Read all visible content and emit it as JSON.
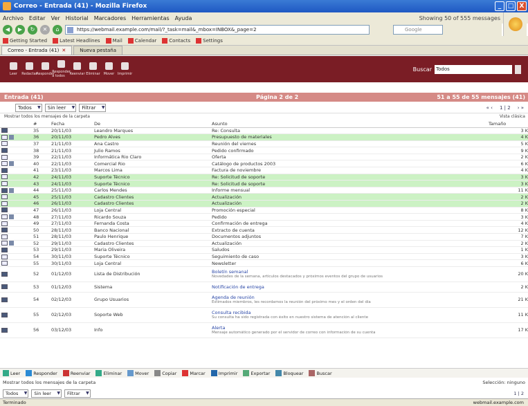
{
  "window": {
    "title": "Correo - Entrada (41) - Mozilla Firefox",
    "min": "_",
    "max": "□",
    "close": "X"
  },
  "menu": [
    "Archivo",
    "Editar",
    "Ver",
    "Historial",
    "Marcadores",
    "Herramientas",
    "Ayuda"
  ],
  "menu_status": "Showing 50 of 555 messages",
  "nav": {
    "url": "https://webmail.example.com/mail/?_task=mail&_mbox=INBOX&_page=2",
    "search_placeholder": "Google"
  },
  "bookmarks": [
    "Getting Started",
    "Latest Headlines",
    "Mail",
    "Calendar",
    "Contacts",
    "Settings"
  ],
  "tabs": [
    {
      "label": "Correo - Entrada (41)"
    },
    {
      "label": "Nueva pestaña"
    }
  ],
  "toolbar": {
    "items": [
      "Leer",
      "Redactar",
      "Responder",
      "Responder a todos",
      "Reenviar",
      "Eliminar",
      "Mover",
      "Imprimir"
    ],
    "search_label": "Buscar",
    "search_value": "Todos"
  },
  "inbox": {
    "folder": "Entrada (41)",
    "page": "Página 2 de 2",
    "count": "51 a 55 de 55 mensajes (41)"
  },
  "filters": {
    "sel1": "Todos",
    "sel2": "Sin leer",
    "sel3": "Filtrar",
    "pager": [
      "« ‹",
      "1 | 2",
      "› »"
    ]
  },
  "subfilter": {
    "left": "Mostrar todos los mensajes de la carpeta",
    "right": "Vista clásica"
  },
  "columns": [
    "",
    "#",
    "Fecha",
    "De",
    "Asunto",
    "Tamaño"
  ],
  "rows": [
    {
      "n": "35",
      "date": "20/11/03",
      "from": "Leandro Marques",
      "subject": "Re: Consulta",
      "size": "3 K",
      "green": false
    },
    {
      "n": "36",
      "date": "20/11/03",
      "from": "Pedro Alves",
      "subject": "Presupuesto de materiales",
      "size": "4 K",
      "green": true
    },
    {
      "n": "37",
      "date": "21/11/03",
      "from": "Ana Castro",
      "subject": "Reunión del viernes",
      "size": "5 K",
      "green": false
    },
    {
      "n": "38",
      "date": "21/11/03",
      "from": "Julio Ramos",
      "subject": "Pedido confirmado",
      "size": "9 K",
      "green": false
    },
    {
      "n": "39",
      "date": "22/11/03",
      "from": "Informática Rio Claro",
      "subject": "Oferta",
      "size": "2 K",
      "green": false
    },
    {
      "n": "40",
      "date": "22/11/03",
      "from": "Comercial Rio",
      "subject": "Catálogo de productos 2003",
      "size": "6 K",
      "green": false
    },
    {
      "n": "41",
      "date": "23/11/03",
      "from": "Marcos Lima",
      "subject": "Factura de noviembre",
      "size": "4 K",
      "green": false
    },
    {
      "n": "42",
      "date": "24/11/03",
      "from": "Suporte Técnico",
      "subject": "Re: Solicitud de soporte",
      "size": "3 K",
      "green": true
    },
    {
      "n": "43",
      "date": "24/11/03",
      "from": "Suporte Técnico",
      "subject": "Re: Solicitud de soporte",
      "size": "3 K",
      "green": true
    },
    {
      "n": "44",
      "date": "25/11/03",
      "from": "Carlos Mendes",
      "subject": "Informe mensual",
      "size": "11 K",
      "green": false
    },
    {
      "n": "45",
      "date": "25/11/03",
      "from": "Cadastro Clientes",
      "subject": "Actualización",
      "size": "2 K",
      "green": true
    },
    {
      "n": "46",
      "date": "26/11/03",
      "from": "Cadastro Clientes",
      "subject": "Actualización",
      "size": "2 K",
      "green": true
    },
    {
      "n": "47",
      "date": "26/11/03",
      "from": "Loja Central",
      "subject": "Promoción especial",
      "size": "8 K",
      "green": false
    },
    {
      "n": "48",
      "date": "27/11/03",
      "from": "Ricardo Souza",
      "subject": "Pedido",
      "size": "3 K",
      "green": false
    },
    {
      "n": "49",
      "date": "27/11/03",
      "from": "Fernanda Costa",
      "subject": "Confirmación de entrega",
      "size": "4 K",
      "green": false
    },
    {
      "n": "50",
      "date": "28/11/03",
      "from": "Banco Nacional",
      "subject": "Extracto de cuenta",
      "size": "12 K",
      "green": false
    },
    {
      "n": "51",
      "date": "28/11/03",
      "from": "Paulo Henrique",
      "subject": "Documentos adjuntos",
      "size": "7 K",
      "green": false
    },
    {
      "n": "52",
      "date": "29/11/03",
      "from": "Cadastro Clientes",
      "subject": "Actualización",
      "size": "2 K",
      "green": false
    },
    {
      "n": "53",
      "date": "29/11/03",
      "from": "Maria Oliveira",
      "subject": "Saludos",
      "size": "1 K",
      "green": false
    },
    {
      "n": "54",
      "date": "30/11/03",
      "from": "Suporte Técnico",
      "subject": "Seguimiento de caso",
      "size": "3 K",
      "green": false
    },
    {
      "n": "55",
      "date": "30/11/03",
      "from": "Loja Central",
      "subject": "Newsletter",
      "size": "6 K",
      "green": false
    }
  ],
  "tall_rows": [
    {
      "n": "52",
      "date": "01/12/03",
      "from": "Lista de Distribución",
      "subject": "Boletín semanal",
      "preview": "Novedades de la semana, artículos destacados y próximos eventos del grupo de usuarios",
      "size": "20 K"
    },
    {
      "n": "53",
      "date": "01/12/03",
      "from": "Sistema",
      "subject": "Notificación de entrega",
      "preview": "",
      "size": "2 K"
    },
    {
      "n": "54",
      "date": "02/12/03",
      "from": "Grupo Usuarios",
      "subject": "Agenda de reunión",
      "preview": "Estimados miembros, les recordamos la reunión del próximo mes y el orden del día",
      "size": "21 K"
    },
    {
      "n": "55",
      "date": "02/12/03",
      "from": "Soporte Web",
      "subject": "Consulta recibida",
      "preview": "Su consulta ha sido registrada con éxito en nuestro sistema de atención al cliente",
      "size": "11 K"
    },
    {
      "n": "56",
      "date": "03/12/03",
      "from": "Info",
      "subject": "Alerta",
      "preview": "Mensaje automático generado por el servidor de correo con información de su cuenta",
      "size": "17 K"
    }
  ],
  "actions": [
    "Leer",
    "Responder",
    "Reenviar",
    "Eliminar",
    "Mover",
    "Copiar",
    "Marcar",
    "Imprimir",
    "Exportar",
    "Bloquear",
    "Buscar"
  ],
  "bottom_status": {
    "left": "Mostrar todos los mensajes de la carpeta",
    "right": "Selección: ninguno"
  },
  "bottom_filter": {
    "sel1": "Todos",
    "sel2": "Sin leer",
    "sel3": "Filtrar",
    "pager": "1 | 2"
  },
  "statusbar": {
    "left": "Terminado",
    "right": "webmail.example.com"
  }
}
